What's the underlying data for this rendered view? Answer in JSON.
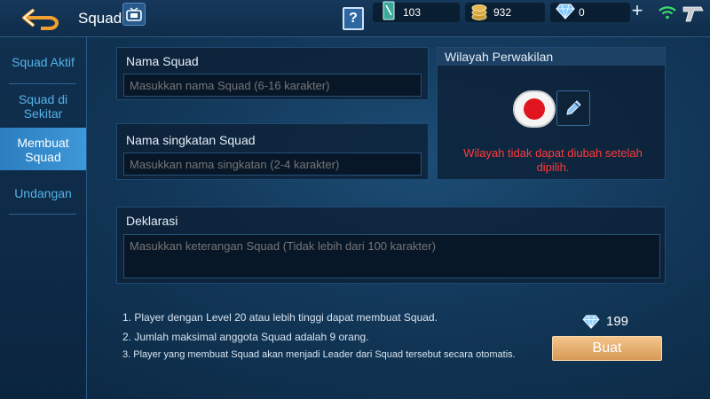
{
  "header": {
    "title": "Squad",
    "help_glyph": "?",
    "currencies": {
      "ticket": "103",
      "gold": "932",
      "diamond": "0"
    },
    "add_glyph": "+"
  },
  "sidebar": {
    "items": [
      {
        "label": "Squad Aktif"
      },
      {
        "label": "Squad di Sekitar"
      },
      {
        "label": "Membuat Squad",
        "active": true
      },
      {
        "label": "Undangan"
      }
    ]
  },
  "form": {
    "name": {
      "label": "Nama Squad",
      "placeholder": "Masukkan nama Squad (6-16 karakter)"
    },
    "short_name": {
      "label": "Nama singkatan Squad",
      "placeholder": "Masukkan nama singkatan (2-4 karakter)"
    },
    "declaration": {
      "label": "Deklarasi",
      "placeholder": "Masukkan keterangan Squad (Tidak lebih dari 100 karakter)"
    }
  },
  "region": {
    "title": "Wilayah Perwakilan",
    "warning": "Wilayah tidak dapat diubah setelah dipilih."
  },
  "notes": [
    "1. Player dengan Level 20 atau lebih tinggi dapat membuat Squad.",
    "2. Jumlah maksimal anggota Squad adalah 9 orang.",
    "3. Player yang membuat Squad akan menjadi Leader dari Squad tersebut secara otomatis."
  ],
  "create": {
    "cost": "199",
    "label": "Buat"
  },
  "icons": {
    "back": "back-arrow-icon",
    "tv": "tv-icon",
    "help": "help-icon",
    "ticket": "ticket-icon",
    "gold": "gold-coin-icon",
    "diamond": "diamond-icon",
    "add": "plus-icon",
    "wifi": "wifi-icon",
    "ping": "signal-gun-icon",
    "flag": "indonesia-flag-icon",
    "edit": "pencil-icon"
  },
  "colors": {
    "accent": "#3f98d8",
    "warning": "#ff3b3b",
    "button": "#d79a56",
    "flag_red": "#e0151f"
  }
}
